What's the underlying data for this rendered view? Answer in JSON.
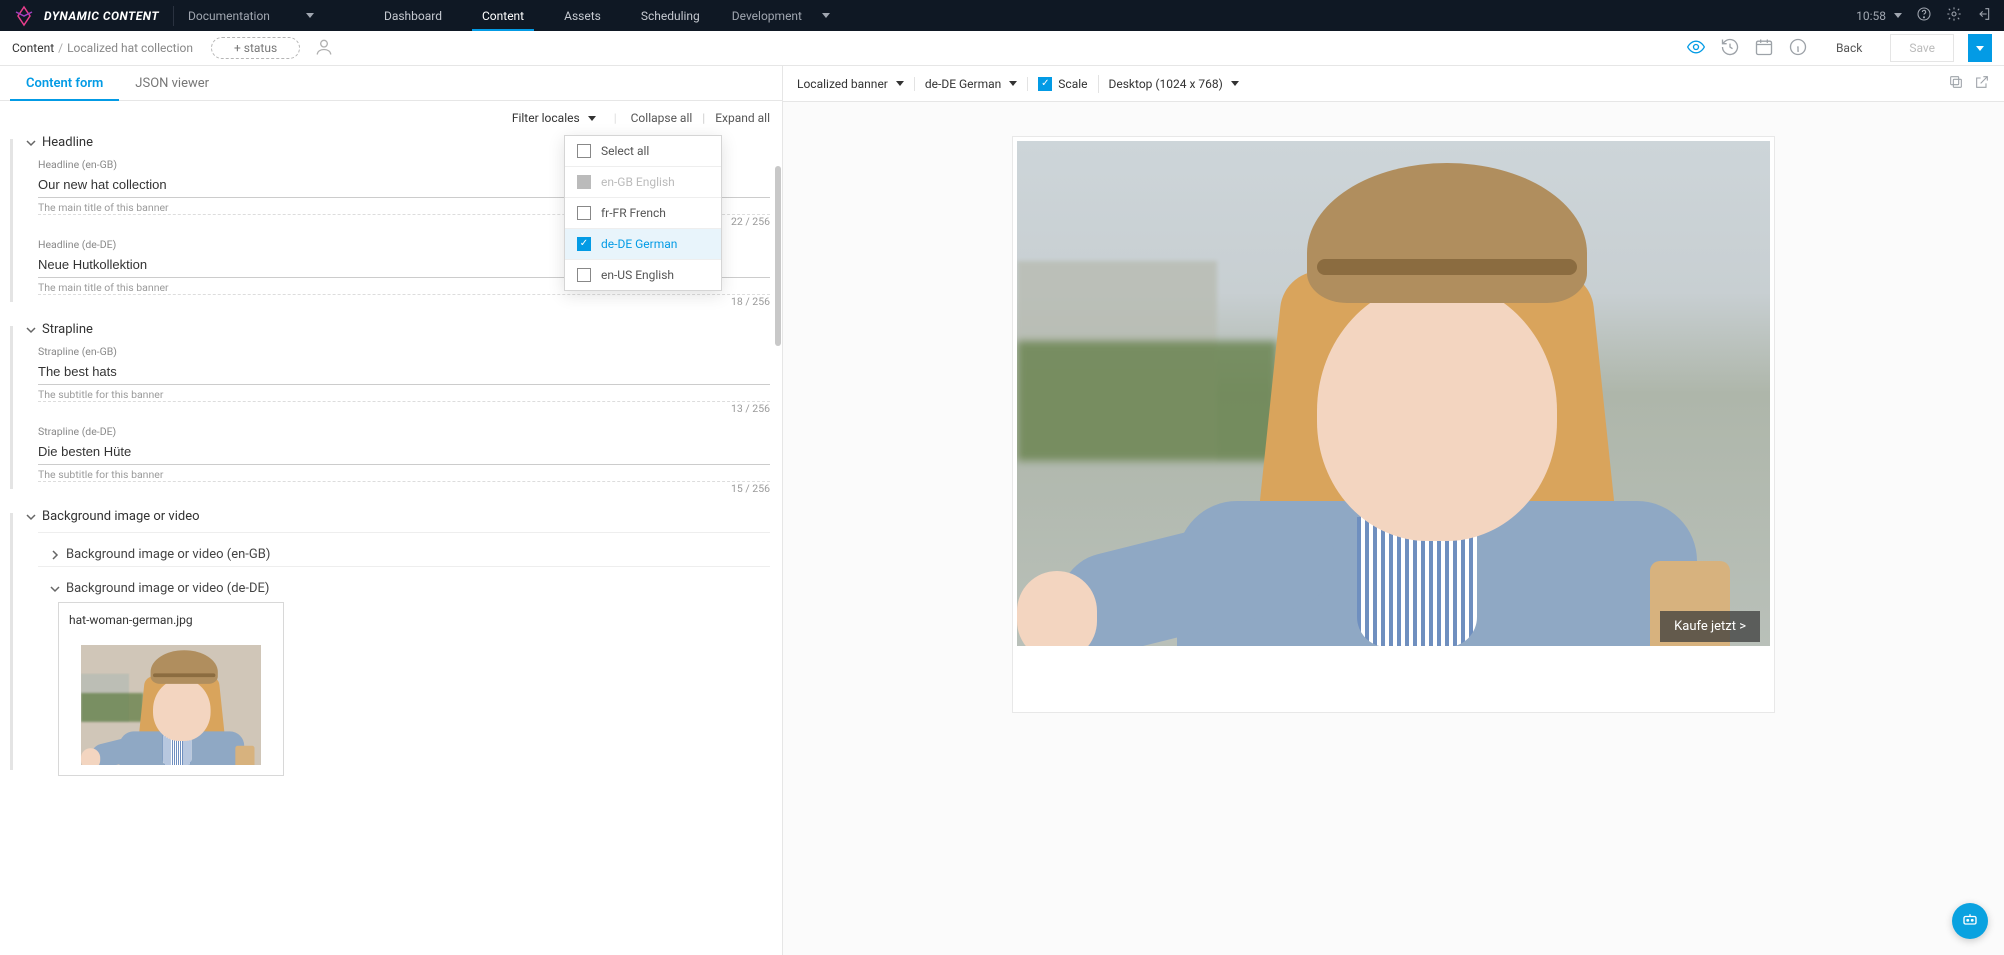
{
  "app": {
    "name": "DYNAMIC CONTENT"
  },
  "nav": {
    "docs": "Documentation",
    "tabs": [
      "Dashboard",
      "Content",
      "Assets",
      "Scheduling"
    ],
    "activeTab": "Content",
    "dev": "Development",
    "time": "10:58"
  },
  "crumb": {
    "root": "Content",
    "current": "Localized hat collection",
    "status": "+ status",
    "back": "Back",
    "save": "Save"
  },
  "leftTabs": {
    "form": "Content form",
    "json": "JSON viewer"
  },
  "filter": {
    "label": "Filter locales",
    "collapse": "Collapse all",
    "expand": "Expand all",
    "options": {
      "selectAll": "Select all",
      "enGB": "en-GB English",
      "frFR": "fr-FR French",
      "deDE": "de-DE German",
      "enUS": "en-US English"
    }
  },
  "sections": {
    "headline": {
      "title": "Headline",
      "enGB": {
        "label": "Headline (en-GB)",
        "value": "Our new hat collection",
        "hint": "The main title of this banner",
        "count": "22 / 256"
      },
      "deDE": {
        "label": "Headline (de-DE)",
        "value": "Neue Hutkollektion",
        "hint": "The main title of this banner",
        "count": "18 / 256"
      }
    },
    "strapline": {
      "title": "Strapline",
      "enGB": {
        "label": "Strapline (en-GB)",
        "value": "The best hats",
        "hint": "The subtitle for this banner",
        "count": "13 / 256"
      },
      "deDE": {
        "label": "Strapline (de-DE)",
        "value": "Die besten Hüte",
        "hint": "The subtitle for this banner",
        "count": "15 / 256"
      }
    },
    "bg": {
      "title": "Background image or video",
      "enGB": "Background image or video (en-GB)",
      "deDE": "Background image or video (de-DE)",
      "asset": "hat-woman-german.jpg"
    }
  },
  "preview": {
    "viz": "Localized banner",
    "locale": "de-DE German",
    "scale": "Scale",
    "device": "Desktop (1024 x 768)",
    "cta": "Kaufe jetzt >"
  }
}
